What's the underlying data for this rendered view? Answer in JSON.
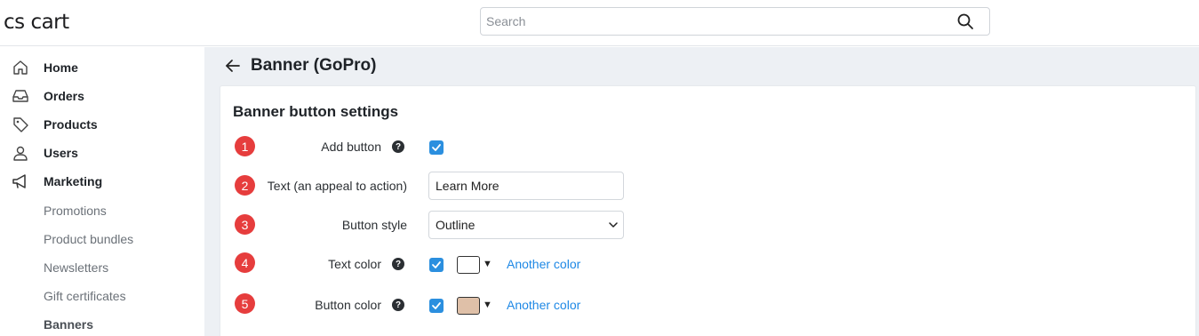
{
  "header": {
    "logo": "cs cart",
    "search_placeholder": "Search"
  },
  "sidebar": {
    "items": [
      {
        "label": "Home",
        "icon": "home-icon"
      },
      {
        "label": "Orders",
        "icon": "inbox-icon"
      },
      {
        "label": "Products",
        "icon": "tag-icon"
      },
      {
        "label": "Users",
        "icon": "user-icon"
      },
      {
        "label": "Marketing",
        "icon": "megaphone-icon"
      }
    ],
    "subitems": [
      {
        "label": "Promotions"
      },
      {
        "label": "Product bundles"
      },
      {
        "label": "Newsletters"
      },
      {
        "label": "Gift certificates"
      },
      {
        "label": "Banners",
        "active": true
      }
    ]
  },
  "page": {
    "title": "Banner (GoPro)",
    "section_title": "Banner button settings"
  },
  "form": {
    "rows": [
      {
        "badge": "1",
        "label": "Add button",
        "help": "?",
        "checked": true
      },
      {
        "badge": "2",
        "label": "Text (an appeal to action)",
        "value": "Learn More"
      },
      {
        "badge": "3",
        "label": "Button style",
        "selected": "Outline"
      },
      {
        "badge": "4",
        "label": "Text color",
        "help": "?",
        "checked": true,
        "swatch_color": "#ffffff",
        "swatch_arrow": "▼",
        "link": "Another color"
      },
      {
        "badge": "5",
        "label": "Button color",
        "help": "?",
        "checked": true,
        "swatch_color": "#dfc0a8",
        "swatch_arrow": "▼",
        "link": "Another color"
      }
    ]
  },
  "colors": {
    "accent": "#2b8fdf",
    "badge": "#e63d3d",
    "link": "#1e88e5",
    "main_bg": "#edf0f4"
  }
}
